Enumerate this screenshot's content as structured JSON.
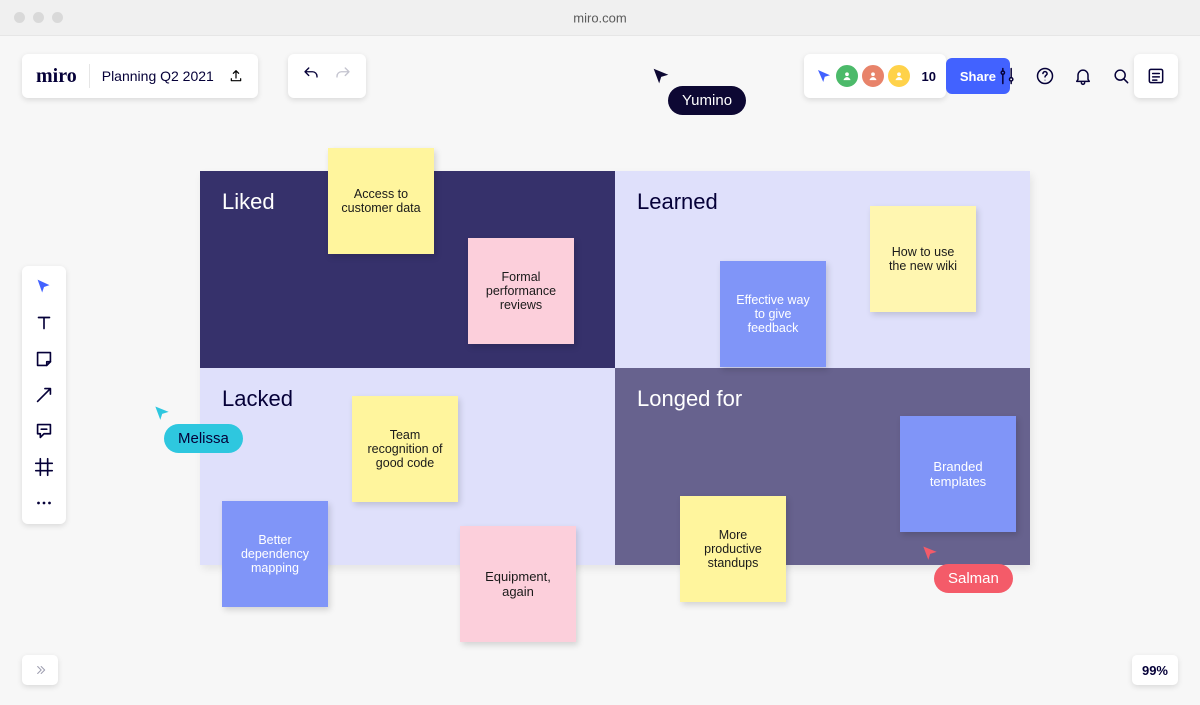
{
  "chrome": {
    "url": "miro.com"
  },
  "header": {
    "logo": "miro",
    "board_title": "Planning Q2 2021",
    "share_label": "Share",
    "participant_overflow": "10"
  },
  "quadrants": {
    "liked": "Liked",
    "learned": "Learned",
    "lacked": "Lacked",
    "longed": "Longed for"
  },
  "stickies": {
    "access": "Access to customer data",
    "reviews": "Formal performance reviews",
    "feedback": "Effective way to give feedback",
    "wiki": "How to use the new wiki",
    "recognition": "Team recognition of good code",
    "dependency": "Better dependency mapping",
    "equipment": "Equipment, again",
    "standups": "More productive standups",
    "branded": "Branded templates"
  },
  "cursors": {
    "yumino": "Yumino",
    "melissa": "Melissa",
    "salman": "Salman"
  },
  "zoom": "99%"
}
